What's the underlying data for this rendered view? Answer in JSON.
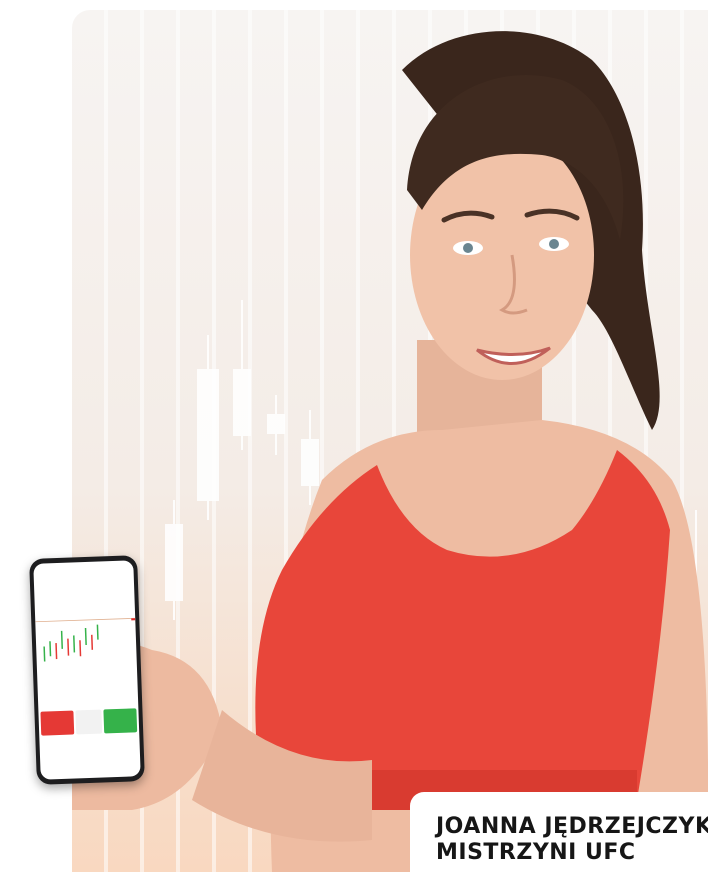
{
  "caption": {
    "name": "JOANNA JĘDRZEJCZYK",
    "title": "MISTRZYNI UFC"
  },
  "colors": {
    "accent_red": "#e8463a",
    "sell_red": "#e53935",
    "buy_green": "#35b24a",
    "text_dark": "#161616"
  },
  "icons": [
    "phone-app-mockup",
    "candlestick-background"
  ]
}
